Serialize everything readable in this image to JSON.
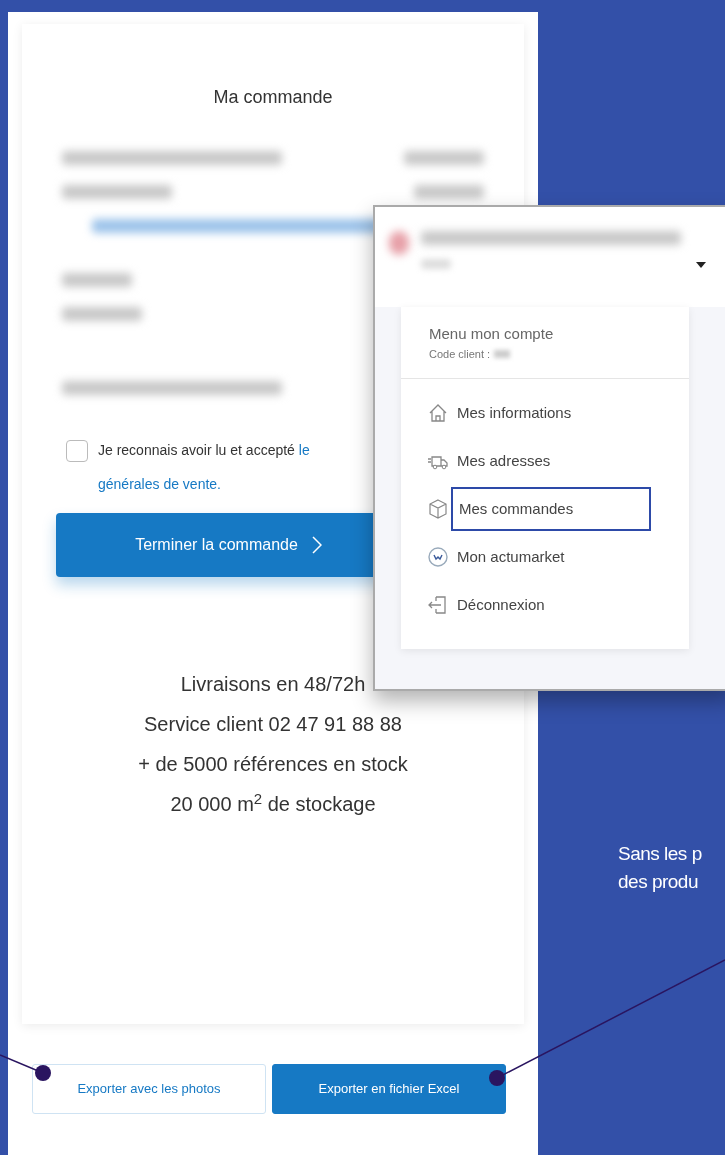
{
  "order_panel": {
    "title": "Ma commande",
    "terms": {
      "checked": false,
      "text": "Je reconnais avoir lu et accepté",
      "link_start": "le",
      "link_end": "générales de vente."
    },
    "submit_button": "Terminer la commande",
    "info_lines": [
      "Livraisons en 48/72h",
      "Service client 02 47 91 88 88",
      "+ de 5000 références en stock",
      "20 000 m$^{2}$ de stockage"
    ]
  },
  "export_buttons": [
    {
      "label": "Exporter avec les photos",
      "kind": "outline"
    },
    {
      "label": "Exporter en fichier Excel",
      "kind": "filled"
    }
  ],
  "account_menu": {
    "title": "Menu mon compte",
    "client_code_label": "Code client :",
    "items": [
      {
        "label": "Mes informations",
        "selected": false
      },
      {
        "label": "Mes adresses",
        "selected": false
      },
      {
        "label": "Mes commandes",
        "selected": true
      },
      {
        "label": "Mon actumarket",
        "selected": false
      },
      {
        "label": "Déconnexion",
        "selected": false
      }
    ]
  },
  "caption_lines": [
    "Sans les p",
    "des produ"
  ]
}
